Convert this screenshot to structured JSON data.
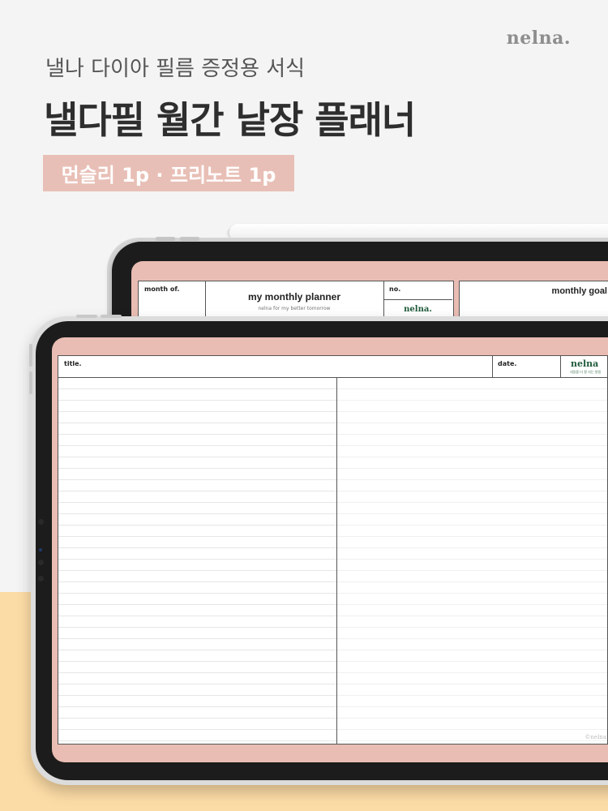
{
  "brand": "nelna.",
  "subtitle": "낼나 다이아 필름 증정용 서식",
  "headline": "낼다필 월간 낱장 플래너",
  "tag": "먼슬리 1p · 프리노트 1p",
  "back_device": {
    "month_label": "month of.",
    "title": "my monthly planner",
    "subtitle": "nelna for my better tomorrow",
    "no_label": "no.",
    "logo": "nelna.",
    "goal_title": "monthly goal"
  },
  "front_device": {
    "title_label": "title.",
    "date_label": "date.",
    "logo": "nelna",
    "logo_sub": "내일을 더 잘 사는 방법",
    "copyright": "©nelna"
  },
  "colors": {
    "accent_pink": "#e8bfb6",
    "screen_pink": "#e9bdb3",
    "bottom_band": "#fcdca6",
    "logo_green": "#1f5a3a"
  }
}
